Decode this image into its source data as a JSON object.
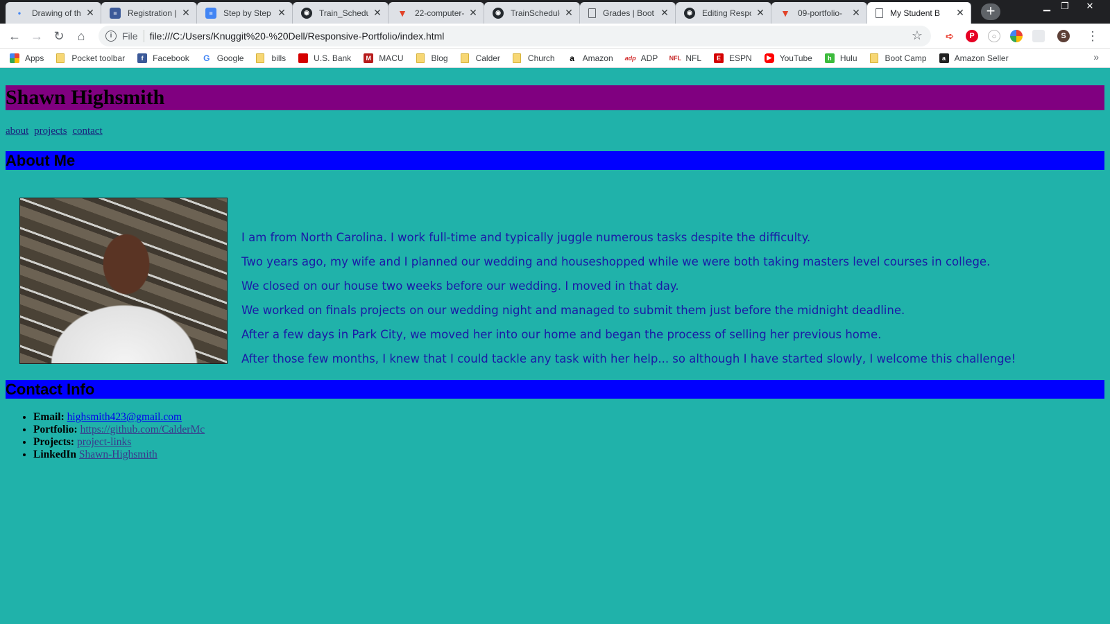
{
  "browser": {
    "tabs": [
      {
        "title": "Drawing of th",
        "icon": "drive-draw-icon",
        "active": false
      },
      {
        "title": "Registration |",
        "icon": "doc-icon",
        "active": false
      },
      {
        "title": "Step by Step C",
        "icon": "google-docs-icon",
        "active": false
      },
      {
        "title": "Train_Schedul",
        "icon": "github-icon",
        "active": false
      },
      {
        "title": "22-computer-",
        "icon": "gitlab-icon",
        "active": false
      },
      {
        "title": "TrainSchedule",
        "icon": "github-icon",
        "active": false
      },
      {
        "title": "Grades | Boot",
        "icon": "page-icon",
        "active": false
      },
      {
        "title": "Editing Respo",
        "icon": "github-icon",
        "active": false
      },
      {
        "title": "09-portfolio-",
        "icon": "gitlab-icon",
        "active": false
      },
      {
        "title": "My Student B",
        "icon": "page-icon",
        "active": true
      }
    ],
    "address": {
      "scheme_label": "File",
      "url": "file:///C:/Users/Knuggit%20-%20Dell/Responsive-Portfolio/index.html"
    },
    "profile_initial": "S",
    "bookmarks": [
      {
        "label": "Apps",
        "icon": "apps-grid-icon"
      },
      {
        "label": "Pocket toolbar",
        "icon": "folder-icon"
      },
      {
        "label": "Facebook",
        "icon": "facebook-icon"
      },
      {
        "label": "Google",
        "icon": "google-icon"
      },
      {
        "label": "bills",
        "icon": "folder-icon"
      },
      {
        "label": "U.S. Bank",
        "icon": "usbank-icon"
      },
      {
        "label": "MACU",
        "icon": "macu-icon"
      },
      {
        "label": "Blog",
        "icon": "folder-icon"
      },
      {
        "label": "Calder",
        "icon": "folder-icon"
      },
      {
        "label": "Church",
        "icon": "folder-icon"
      },
      {
        "label": "Amazon",
        "icon": "amazon-icon"
      },
      {
        "label": "ADP",
        "icon": "adp-icon"
      },
      {
        "label": "NFL",
        "icon": "nfl-icon"
      },
      {
        "label": "ESPN",
        "icon": "espn-icon"
      },
      {
        "label": "YouTube",
        "icon": "youtube-icon"
      },
      {
        "label": "Hulu",
        "icon": "hulu-icon"
      },
      {
        "label": "Boot Camp",
        "icon": "folder-icon"
      },
      {
        "label": "Amazon Seller",
        "icon": "amazon-seller-icon"
      }
    ]
  },
  "page": {
    "site_title": "Shawn Highsmith",
    "nav": [
      "about",
      "projects",
      "contact"
    ],
    "about_heading": "About Me",
    "about_paragraphs": [
      "I am from North Carolina. I work full-time and typically juggle numerous tasks despite the difficulty.",
      "Two years ago, my wife and I planned our wedding and houseshopped while we were both taking masters level courses in college.",
      "We closed on our house two weeks before our wedding. I moved in that day.",
      "We worked on finals projects on our wedding night and managed to submit them just before the midnight deadline.",
      "After a few days in Park City, we moved her into our home and began the process of selling her previous home.",
      "After those few months, I knew that I could tackle any task with her help... so although I have started slowly, I welcome this challenge!"
    ],
    "contact_heading": "Contact Info",
    "contact": [
      {
        "label": "Email:",
        "value": "highsmith423@gmail.com"
      },
      {
        "label": "Portfolio:",
        "value": "https://github.com/CalderMc"
      },
      {
        "label": "Projects:",
        "value": "project-links"
      },
      {
        "label": "LinkedIn",
        "value": "Shawn-Highsmith"
      }
    ]
  },
  "colors": {
    "page_bg": "#20b2aa",
    "header_bg": "#800080",
    "section_bar_bg": "#0000ff",
    "about_text": "#1a1aa6"
  }
}
